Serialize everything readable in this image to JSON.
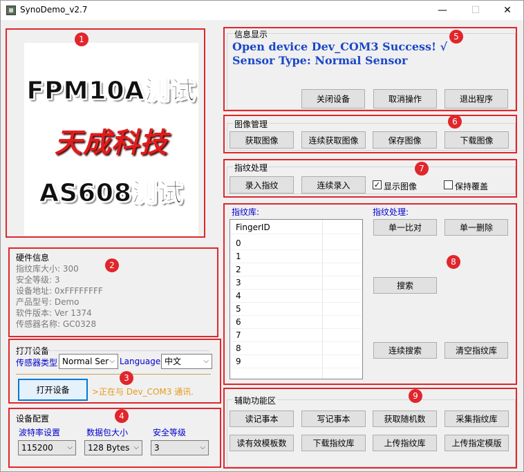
{
  "window": {
    "title": "SynoDemo_v2.7",
    "min": "—",
    "max": "☐",
    "close": "✕"
  },
  "badges": [
    "1",
    "2",
    "3",
    "4",
    "5",
    "6",
    "7",
    "8",
    "9"
  ],
  "logo": {
    "line1": "FPM10A测试",
    "line2": "天成科技",
    "line3": "AS608测试"
  },
  "hardware": {
    "title": "硬件信息",
    "lines": [
      "指纹库大小: 300",
      "安全等级: 3",
      "设备地址: 0xFFFFFFFF",
      "产品型号:  Demo",
      "软件版本: Ver 1374",
      "传感器名称: GC0328"
    ]
  },
  "open_device": {
    "title": "打开设备",
    "sensor_label": "传感器类型",
    "sensor_value": "Normal Ser",
    "language_label": "Language",
    "language_value": "中文",
    "open_button": "打开设备",
    "status": ">正在与 Dev_COM3 通讯."
  },
  "device_config": {
    "title": "设备配置",
    "baud_label": "波特率设置",
    "baud_value": "115200",
    "packet_label": "数据包大小",
    "packet_value": "128 Bytes",
    "security_label": "安全等级",
    "security_value": "3"
  },
  "info_display": {
    "title": "信息显示",
    "line1": "Open device Dev_COM3 Success! √",
    "line2": "Sensor Type: Normal Sensor",
    "buttons": [
      "关闭设备",
      "取消操作",
      "退出程序"
    ]
  },
  "image_mgmt": {
    "title": "图像管理",
    "buttons": [
      "获取图像",
      "连续获取图像",
      "保存图像",
      "下载图像"
    ]
  },
  "fp_process": {
    "title": "指纹处理",
    "buttons": [
      "录入指纹",
      "连续录入"
    ],
    "show_image": "显示图像",
    "keep_cover": "保持覆盖",
    "show_image_checked": true,
    "keep_cover_checked": false
  },
  "fp_library": {
    "lib_label": "指纹库:",
    "proc_label": "指纹处理:",
    "column": "FingerID",
    "ids": [
      "0",
      "1",
      "2",
      "3",
      "4",
      "5",
      "6",
      "7",
      "8",
      "9"
    ],
    "buttons": {
      "single_compare": "单一比对",
      "single_delete": "单一删除",
      "search": "搜索",
      "continuous_search": "连续搜索",
      "clear_lib": "清空指纹库"
    }
  },
  "aux": {
    "title": "辅助功能区",
    "row1": [
      "读记事本",
      "写记事本",
      "获取随机数",
      "采集指纹库"
    ],
    "row2": [
      "读有效模板数",
      "下载指纹库",
      "上传指纹库",
      "上传指定模版"
    ]
  }
}
